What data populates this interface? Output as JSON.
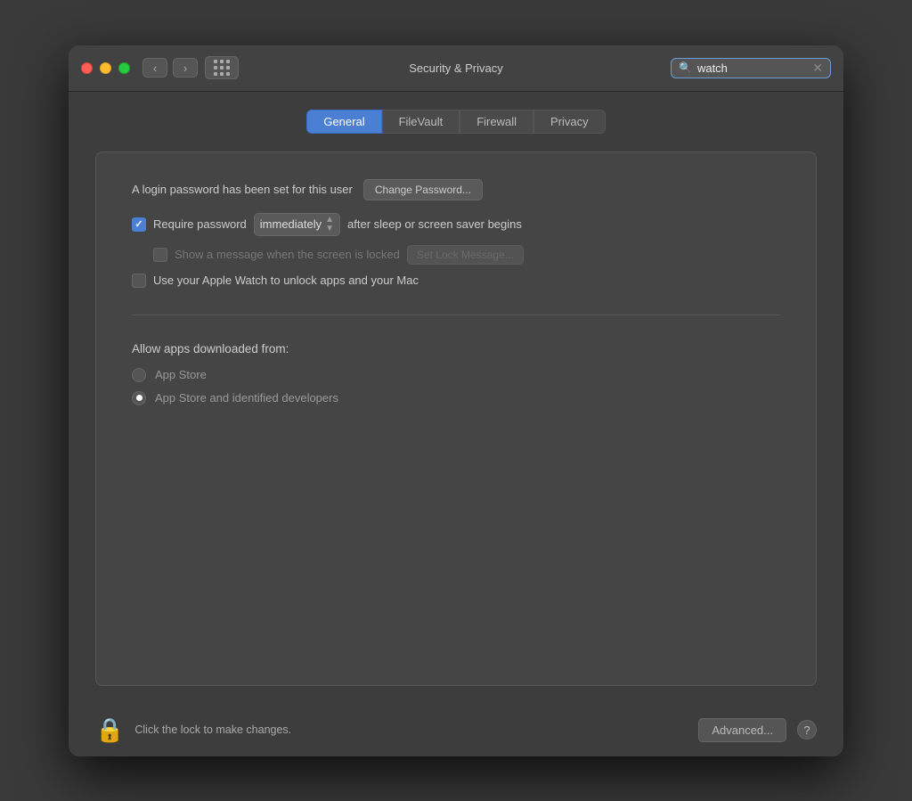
{
  "window": {
    "title": "Security & Privacy",
    "search_placeholder": "watch",
    "search_value": "watch"
  },
  "tabs": [
    {
      "id": "general",
      "label": "General",
      "active": true
    },
    {
      "id": "filevault",
      "label": "FileVault",
      "active": false
    },
    {
      "id": "firewall",
      "label": "Firewall",
      "active": false
    },
    {
      "id": "privacy",
      "label": "Privacy",
      "active": false
    }
  ],
  "general": {
    "login_password_text": "A login password has been set for this user",
    "change_password_btn": "Change Password...",
    "require_password_label": "Require password",
    "immediately_value": "immediately",
    "after_sleep_text": "after sleep or screen saver begins",
    "show_lock_message_label": "Show a message when the screen is locked",
    "set_lock_message_btn": "Set Lock Message...",
    "apple_watch_label": "Use your Apple Watch to unlock apps and your Mac",
    "allow_apps_label": "Allow apps downloaded from:",
    "radio_app_store": "App Store",
    "radio_app_store_identified": "App Store and identified developers"
  },
  "bottom": {
    "lock_text": "Click the lock to make changes.",
    "advanced_btn": "Advanced...",
    "help_label": "?"
  },
  "icons": {
    "close": "close-traffic-light",
    "minimize": "minimize-traffic-light",
    "maximize": "maximize-traffic-light",
    "back": "‹",
    "forward": "›",
    "search": "🔍",
    "clear": "✕",
    "lock": "🔒"
  }
}
